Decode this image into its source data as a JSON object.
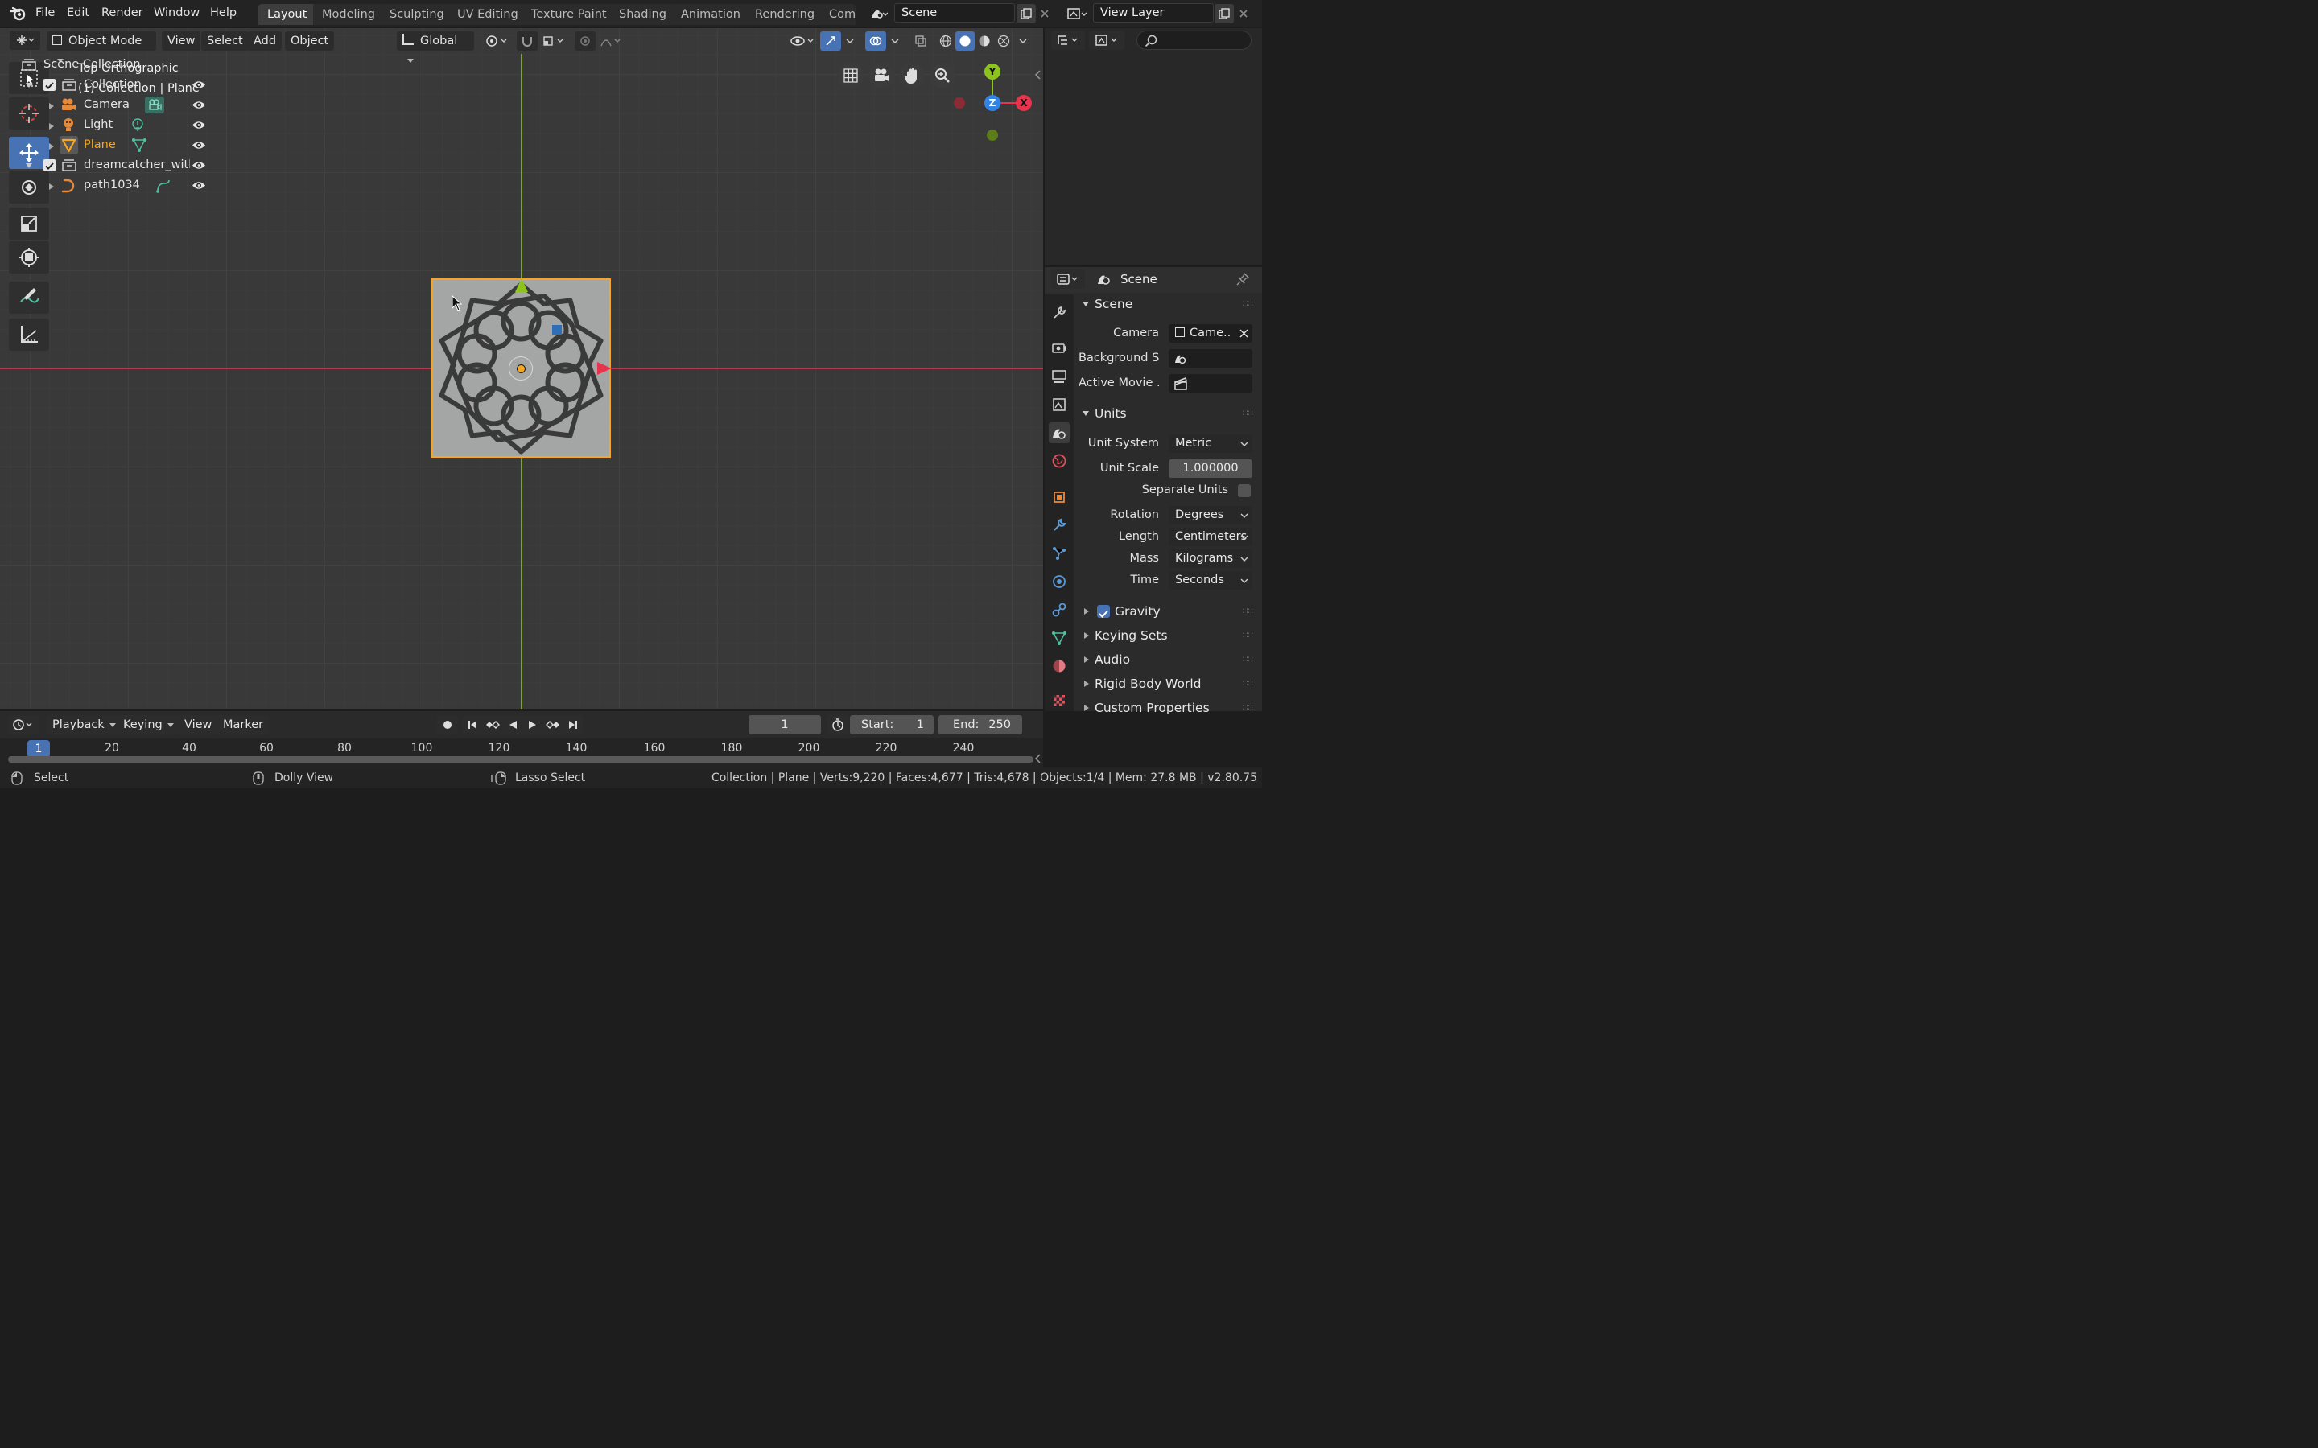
{
  "menubar": {
    "items": [
      "File",
      "Edit",
      "Render",
      "Window",
      "Help"
    ]
  },
  "workspaces": [
    "Layout",
    "Modeling",
    "Sculpting",
    "UV Editing",
    "Texture Paint",
    "Shading",
    "Animation",
    "Rendering",
    "Com"
  ],
  "scene_field": "Scene",
  "view_layer_field": "View Layer",
  "viewport_header": {
    "mode": "Object Mode",
    "menus": [
      "View",
      "Select",
      "Add",
      "Object"
    ],
    "orientation": "Global"
  },
  "viewport": {
    "view_name": "Top Orthographic",
    "collection_info": "(1) Collection | Plane"
  },
  "gizmo": {
    "y": "Y",
    "z": "Z",
    "x": "X"
  },
  "outliner": {
    "root": "Scene Collection",
    "items": [
      {
        "label": "Collection"
      },
      {
        "label": "Camera"
      },
      {
        "label": "Light"
      },
      {
        "label": "Plane"
      },
      {
        "label": "dreamcatcher_with_"
      },
      {
        "label": "path1034"
      }
    ]
  },
  "properties": {
    "header": "Scene",
    "scene_section": "Scene",
    "camera_label": "Camera",
    "camera_value": "Came..",
    "background_label": "Background S..",
    "active_movie_label": "Active Movie ..",
    "units_section": "Units",
    "unit_system_label": "Unit System",
    "unit_system_value": "Metric",
    "unit_scale_label": "Unit Scale",
    "unit_scale_value": "1.000000",
    "separate_units_label": "Separate Units",
    "rotation_label": "Rotation",
    "rotation_value": "Degrees",
    "length_label": "Length",
    "length_value": "Centimeters",
    "mass_label": "Mass",
    "mass_value": "Kilograms",
    "time_label": "Time",
    "time_value": "Seconds",
    "gravity": "Gravity",
    "keying_sets": "Keying Sets",
    "audio": "Audio",
    "rigid_body": "Rigid Body World",
    "custom_props": "Custom Properties"
  },
  "timeline": {
    "menus": [
      "Playback",
      "Keying",
      "View",
      "Marker"
    ],
    "current_frame": "1",
    "start_label": "Start:",
    "start_value": "1",
    "end_label": "End:",
    "end_value": "250",
    "ruler": [
      "20",
      "40",
      "60",
      "80",
      "100",
      "120",
      "140",
      "160",
      "180",
      "200",
      "220",
      "240"
    ],
    "playhead": "1"
  },
  "statusbar": {
    "select": "Select",
    "dolly": "Dolly View",
    "lasso": "Lasso Select",
    "stats": "Collection | Plane | Verts:9,220 | Faces:4,677 | Tris:4,678 | Objects:1/4 | Mem: 27.8 MB | v2.80.75"
  },
  "colors": {
    "accent": "#4772b3",
    "selected": "#ffa733",
    "x_axis": "#e8334d",
    "y_axis": "#8cc41c",
    "z_axis": "#2f84e6"
  }
}
